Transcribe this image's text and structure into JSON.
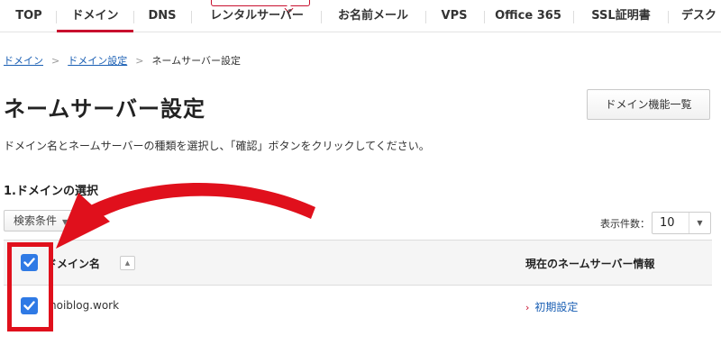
{
  "nav": {
    "tabs": [
      {
        "label": "TOP"
      },
      {
        "label": "ドメイン"
      },
      {
        "label": "DNS"
      },
      {
        "label": "レンタルサーバー"
      },
      {
        "label": "お名前メール"
      },
      {
        "label": "VPS"
      },
      {
        "label": "Office 365"
      },
      {
        "label": "SSL証明書"
      },
      {
        "label": "デスク"
      }
    ],
    "active_tab": "ドメイン"
  },
  "breadcrumb": {
    "items": [
      "ドメイン",
      "ドメイン設定",
      "ネームサーバー設定"
    ],
    "separator": ">"
  },
  "page": {
    "title": "ネームサーバー設定",
    "domain_list_button": "ドメイン機能一覧",
    "description": "ドメイン名とネームサーバーの種類を選択し、「確認」ボタンをクリックしてください。"
  },
  "section": {
    "heading": "1.ドメインの選択",
    "filter_button": "検索条件",
    "per_page_label": "表示件数：",
    "per_page_value": "10"
  },
  "table": {
    "headers": {
      "domain": "ドメイン名",
      "nameserver": "現在のネームサーバー情報"
    },
    "select_all_checked": true,
    "rows": [
      {
        "domain": "hoiblog.work",
        "nameserver": "初期設定",
        "checked": true
      }
    ]
  },
  "colors": {
    "brand_red": "#c8102e",
    "annotation_red": "#e0101c",
    "checkbox_blue": "#2f7ae5",
    "link_blue": "#1a5fb4"
  }
}
